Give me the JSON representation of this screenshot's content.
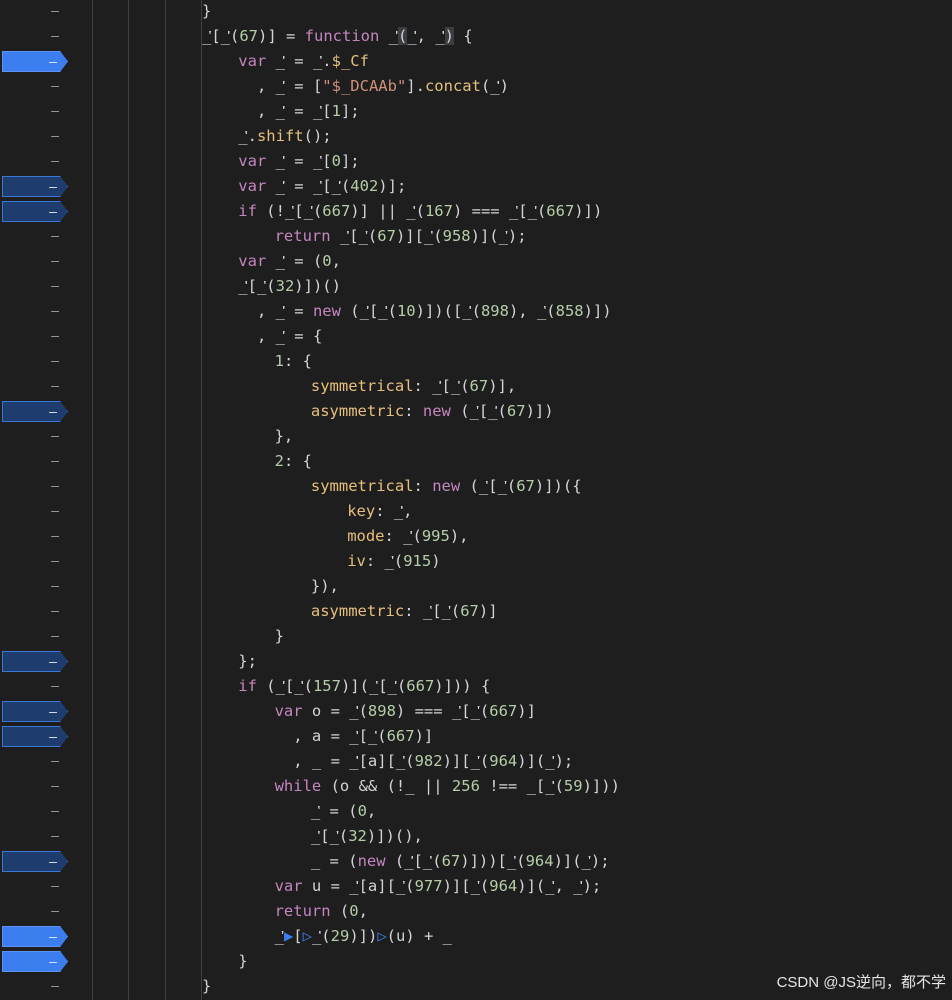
{
  "gutter": {
    "line_count": 40,
    "breakpoints": [
      {
        "line": 2,
        "active": true
      },
      {
        "line": 7,
        "active": false
      },
      {
        "line": 8,
        "active": false
      },
      {
        "line": 16,
        "active": false
      },
      {
        "line": 26,
        "active": false
      },
      {
        "line": 28,
        "active": false
      },
      {
        "line": 29,
        "active": false
      },
      {
        "line": 34,
        "active": false
      },
      {
        "line": 37,
        "active": true
      },
      {
        "line": 38,
        "active": true
      }
    ],
    "marker": "–"
  },
  "code_lines": [
    {
      "indent": 3,
      "tokens": [
        {
          "t": "}",
          "c": "plain"
        }
      ]
    },
    {
      "indent": 3,
      "tokens": [
        {
          "t": "_ᡃᡃᡃᡃ[_ᡃᡃᡃᡃ(",
          "c": "ident"
        },
        {
          "t": "67",
          "c": "num"
        },
        {
          "t": ")] = ",
          "c": "plain"
        },
        {
          "t": "function",
          "c": "kw"
        },
        {
          "t": " _ᡃᡃᡃᡃ",
          "c": "ident"
        },
        {
          "t": "(",
          "c": "sel"
        },
        {
          "t": "_ᡃᡃᡃᡃ, _ᡃᡃᡃᡃ",
          "c": "ident"
        },
        {
          "t": ")",
          "c": "sel"
        },
        {
          "t": " {",
          "c": "plain"
        }
      ]
    },
    {
      "indent": 4,
      "tokens": [
        {
          "t": "var",
          "c": "kw"
        },
        {
          "t": " _ᡃᡃᡃᡃ = _ᡃᡃᡃᡃ.",
          "c": "ident"
        },
        {
          "t": "$_Cf",
          "c": "prop"
        }
      ]
    },
    {
      "indent": 4,
      "tokens": [
        {
          "t": "  , _ᡃᡃᡃᡃ = [",
          "c": "ident"
        },
        {
          "t": "\"$_DCAAb\"",
          "c": "str"
        },
        {
          "t": "].",
          "c": "plain"
        },
        {
          "t": "concat",
          "c": "prop"
        },
        {
          "t": "(_ᡃᡃᡃᡃ)",
          "c": "ident"
        }
      ]
    },
    {
      "indent": 4,
      "tokens": [
        {
          "t": "  , _ᡃᡃᡃᡃ = _ᡃᡃᡃᡃ[",
          "c": "ident"
        },
        {
          "t": "1",
          "c": "num"
        },
        {
          "t": "];",
          "c": "plain"
        }
      ]
    },
    {
      "indent": 4,
      "tokens": [
        {
          "t": "_ᡃᡃᡃᡃ.",
          "c": "ident"
        },
        {
          "t": "shift",
          "c": "prop"
        },
        {
          "t": "();",
          "c": "plain"
        }
      ]
    },
    {
      "indent": 4,
      "tokens": [
        {
          "t": "var",
          "c": "kw"
        },
        {
          "t": " _ᡃᡃᡃᡃ = _ᡃᡃᡃᡃ[",
          "c": "ident"
        },
        {
          "t": "0",
          "c": "num"
        },
        {
          "t": "];",
          "c": "plain"
        }
      ]
    },
    {
      "indent": 4,
      "tokens": [
        {
          "t": "var",
          "c": "kw"
        },
        {
          "t": " _ᡃᡃᡃᡃ = _ᡃᡃᡃᡃ[_ᡃᡃᡃᡃ(",
          "c": "ident"
        },
        {
          "t": "402",
          "c": "num"
        },
        {
          "t": ")];",
          "c": "plain"
        }
      ]
    },
    {
      "indent": 4,
      "tokens": [
        {
          "t": "if",
          "c": "kw"
        },
        {
          "t": " (!_ᡃᡃᡃᡃ[_ᡃᡃᡃᡃ(",
          "c": "ident"
        },
        {
          "t": "667",
          "c": "num"
        },
        {
          "t": ")] || _ᡃᡃᡃᡃ(",
          "c": "ident"
        },
        {
          "t": "167",
          "c": "num"
        },
        {
          "t": ") === _ᡃᡃᡃᡃ[_ᡃᡃᡃᡃ(",
          "c": "ident"
        },
        {
          "t": "667",
          "c": "num"
        },
        {
          "t": ")])",
          "c": "plain"
        }
      ]
    },
    {
      "indent": 5,
      "tokens": [
        {
          "t": "return",
          "c": "kw"
        },
        {
          "t": " _ᡃᡃᡃᡃ[_ᡃᡃᡃᡃ(",
          "c": "ident"
        },
        {
          "t": "67",
          "c": "num"
        },
        {
          "t": ")][_ᡃᡃᡃᡃ(",
          "c": "ident"
        },
        {
          "t": "958",
          "c": "num"
        },
        {
          "t": ")](_ᡃᡃᡃᡃ);",
          "c": "ident"
        }
      ]
    },
    {
      "indent": 4,
      "tokens": [
        {
          "t": "var",
          "c": "kw"
        },
        {
          "t": " _ᡃᡃᡃᡃ = (",
          "c": "ident"
        },
        {
          "t": "0",
          "c": "num"
        },
        {
          "t": ",",
          "c": "plain"
        }
      ]
    },
    {
      "indent": 4,
      "tokens": [
        {
          "t": "_ᡃᡃᡃᡃ[_ᡃᡃᡃᡃ(",
          "c": "ident"
        },
        {
          "t": "32",
          "c": "num"
        },
        {
          "t": ")])()",
          "c": "plain"
        }
      ]
    },
    {
      "indent": 4,
      "tokens": [
        {
          "t": "  , _ᡃᡃᡃᡃ = ",
          "c": "ident"
        },
        {
          "t": "new",
          "c": "kw"
        },
        {
          "t": " (_ᡃᡃᡃᡃ[_ᡃᡃᡃᡃ(",
          "c": "ident"
        },
        {
          "t": "10",
          "c": "num"
        },
        {
          "t": ")])([_ᡃᡃᡃᡃ(",
          "c": "ident"
        },
        {
          "t": "898",
          "c": "num"
        },
        {
          "t": "), _ᡃᡃᡃᡃ(",
          "c": "ident"
        },
        {
          "t": "858",
          "c": "num"
        },
        {
          "t": ")])",
          "c": "plain"
        }
      ]
    },
    {
      "indent": 4,
      "tokens": [
        {
          "t": "  , _ᡃᡃᡃᡃ = {",
          "c": "ident"
        }
      ]
    },
    {
      "indent": 5,
      "tokens": [
        {
          "t": "1",
          "c": "num"
        },
        {
          "t": ": {",
          "c": "plain"
        }
      ]
    },
    {
      "indent": 6,
      "tokens": [
        {
          "t": "symmetrical",
          "c": "prop"
        },
        {
          "t": ": _ᡃᡃᡃᡃ[_ᡃᡃᡃᡃ(",
          "c": "ident"
        },
        {
          "t": "67",
          "c": "num"
        },
        {
          "t": ")],",
          "c": "plain"
        }
      ]
    },
    {
      "indent": 6,
      "tokens": [
        {
          "t": "asymmetric",
          "c": "prop"
        },
        {
          "t": ": ",
          "c": "plain"
        },
        {
          "t": "new",
          "c": "kw"
        },
        {
          "t": " (_ᡃᡃᡃᡃ[_ᡃᡃᡃᡃ(",
          "c": "ident"
        },
        {
          "t": "67",
          "c": "num"
        },
        {
          "t": ")])",
          "c": "plain"
        }
      ]
    },
    {
      "indent": 5,
      "tokens": [
        {
          "t": "},",
          "c": "plain"
        }
      ]
    },
    {
      "indent": 5,
      "tokens": [
        {
          "t": "2",
          "c": "num"
        },
        {
          "t": ": {",
          "c": "plain"
        }
      ]
    },
    {
      "indent": 6,
      "tokens": [
        {
          "t": "symmetrical",
          "c": "prop"
        },
        {
          "t": ": ",
          "c": "plain"
        },
        {
          "t": "new",
          "c": "kw"
        },
        {
          "t": " (_ᡃᡃᡃᡃ[_ᡃᡃᡃᡃ(",
          "c": "ident"
        },
        {
          "t": "67",
          "c": "num"
        },
        {
          "t": ")])({",
          "c": "plain"
        }
      ]
    },
    {
      "indent": 7,
      "tokens": [
        {
          "t": "key",
          "c": "prop"
        },
        {
          "t": ": _ᡃᡃᡃᡃ,",
          "c": "ident"
        }
      ]
    },
    {
      "indent": 7,
      "tokens": [
        {
          "t": "mode",
          "c": "prop"
        },
        {
          "t": ": _ᡃᡃᡃᡃ(",
          "c": "ident"
        },
        {
          "t": "995",
          "c": "num"
        },
        {
          "t": "),",
          "c": "plain"
        }
      ]
    },
    {
      "indent": 7,
      "tokens": [
        {
          "t": "iv",
          "c": "prop"
        },
        {
          "t": ": _ᡃᡃᡃᡃ(",
          "c": "ident"
        },
        {
          "t": "915",
          "c": "num"
        },
        {
          "t": ")",
          "c": "plain"
        }
      ]
    },
    {
      "indent": 6,
      "tokens": [
        {
          "t": "}),",
          "c": "plain"
        }
      ]
    },
    {
      "indent": 6,
      "tokens": [
        {
          "t": "asymmetric",
          "c": "prop"
        },
        {
          "t": ": _ᡃᡃᡃᡃ[_ᡃᡃᡃᡃ(",
          "c": "ident"
        },
        {
          "t": "67",
          "c": "num"
        },
        {
          "t": ")]",
          "c": "plain"
        }
      ]
    },
    {
      "indent": 5,
      "tokens": [
        {
          "t": "}",
          "c": "plain"
        }
      ]
    },
    {
      "indent": 4,
      "tokens": [
        {
          "t": "};",
          "c": "plain"
        }
      ]
    },
    {
      "indent": 4,
      "tokens": [
        {
          "t": "if",
          "c": "kw"
        },
        {
          "t": " (_ᡃᡃᡃᡃ[_ᡃᡃᡃᡃ(",
          "c": "ident"
        },
        {
          "t": "157",
          "c": "num"
        },
        {
          "t": ")](_ᡃᡃᡃᡃ[_ᡃᡃᡃᡃ(",
          "c": "ident"
        },
        {
          "t": "667",
          "c": "num"
        },
        {
          "t": ")])) {",
          "c": "plain"
        }
      ]
    },
    {
      "indent": 5,
      "tokens": [
        {
          "t": "var",
          "c": "kw"
        },
        {
          "t": " o = _ᡃᡃᡃᡃ(",
          "c": "ident"
        },
        {
          "t": "898",
          "c": "num"
        },
        {
          "t": ") === _ᡃᡃᡃᡃ[_ᡃᡃᡃᡃ(",
          "c": "ident"
        },
        {
          "t": "667",
          "c": "num"
        },
        {
          "t": ")]",
          "c": "plain"
        }
      ]
    },
    {
      "indent": 5,
      "tokens": [
        {
          "t": "  , a = _ᡃᡃᡃᡃ[_ᡃᡃᡃᡃ(",
          "c": "ident"
        },
        {
          "t": "667",
          "c": "num"
        },
        {
          "t": ")]",
          "c": "plain"
        }
      ]
    },
    {
      "indent": 5,
      "tokens": [
        {
          "t": "  , _ = _ᡃᡃᡃᡃ[a][_ᡃᡃᡃᡃ(",
          "c": "ident"
        },
        {
          "t": "982",
          "c": "num"
        },
        {
          "t": ")][_ᡃᡃᡃᡃ(",
          "c": "ident"
        },
        {
          "t": "964",
          "c": "num"
        },
        {
          "t": ")](_ᡃᡃᡃᡃ);",
          "c": "ident"
        }
      ]
    },
    {
      "indent": 5,
      "tokens": [
        {
          "t": "while",
          "c": "kw"
        },
        {
          "t": " (o && (!_ || ",
          "c": "ident"
        },
        {
          "t": "256",
          "c": "num"
        },
        {
          "t": " !== _[_ᡃᡃᡃᡃ(",
          "c": "ident"
        },
        {
          "t": "59",
          "c": "num"
        },
        {
          "t": ")]))",
          "c": "plain"
        }
      ]
    },
    {
      "indent": 6,
      "tokens": [
        {
          "t": "_ᡃᡃᡃᡃ = (",
          "c": "ident"
        },
        {
          "t": "0",
          "c": "num"
        },
        {
          "t": ",",
          "c": "plain"
        }
      ]
    },
    {
      "indent": 6,
      "tokens": [
        {
          "t": "_ᡃᡃᡃᡃ[_ᡃᡃᡃᡃ(",
          "c": "ident"
        },
        {
          "t": "32",
          "c": "num"
        },
        {
          "t": ")])(),",
          "c": "plain"
        }
      ]
    },
    {
      "indent": 6,
      "tokens": [
        {
          "t": "_ = (",
          "c": "ident"
        },
        {
          "t": "new",
          "c": "kw"
        },
        {
          "t": " (_ᡃᡃᡃᡃ[_ᡃᡃᡃᡃ(",
          "c": "ident"
        },
        {
          "t": "67",
          "c": "num"
        },
        {
          "t": ")]))[_ᡃᡃᡃᡃ(",
          "c": "ident"
        },
        {
          "t": "964",
          "c": "num"
        },
        {
          "t": ")](_ᡃᡃᡃᡃ);",
          "c": "ident"
        }
      ]
    },
    {
      "indent": 5,
      "tokens": [
        {
          "t": "var",
          "c": "kw"
        },
        {
          "t": " u = _ᡃᡃᡃᡃ[a][_ᡃᡃᡃᡃ(",
          "c": "ident"
        },
        {
          "t": "977",
          "c": "num"
        },
        {
          "t": ")][_ᡃᡃᡃᡃ(",
          "c": "ident"
        },
        {
          "t": "964",
          "c": "num"
        },
        {
          "t": ")](_ᡃᡃᡃᡃ, _ᡃᡃᡃᡃ);",
          "c": "ident"
        }
      ]
    },
    {
      "indent": 5,
      "tokens": [
        {
          "t": "return",
          "c": "kw"
        },
        {
          "t": " (",
          "c": "plain"
        },
        {
          "t": "0",
          "c": "num"
        },
        {
          "t": ",",
          "c": "plain"
        }
      ]
    },
    {
      "indent": 5,
      "tokens": [
        {
          "t": "_ᡃᡃᡃᡃ",
          "c": "ident"
        },
        {
          "t": "▶",
          "c": "mark"
        },
        {
          "t": "[",
          "c": "plain"
        },
        {
          "t": "▷",
          "c": "mark"
        },
        {
          "t": "_ᡃᡃᡃᡃ(",
          "c": "ident"
        },
        {
          "t": "29",
          "c": "num"
        },
        {
          "t": ")])",
          "c": "plain"
        },
        {
          "t": "▷",
          "c": "mark"
        },
        {
          "t": "(u) + _",
          "c": "ident"
        }
      ]
    },
    {
      "indent": 4,
      "tokens": [
        {
          "t": "}",
          "c": "plain"
        }
      ]
    },
    {
      "indent": 3,
      "tokens": [
        {
          "t": "}",
          "c": "plain"
        }
      ]
    }
  ],
  "watermark": "CSDN @JS逆向，都不学"
}
